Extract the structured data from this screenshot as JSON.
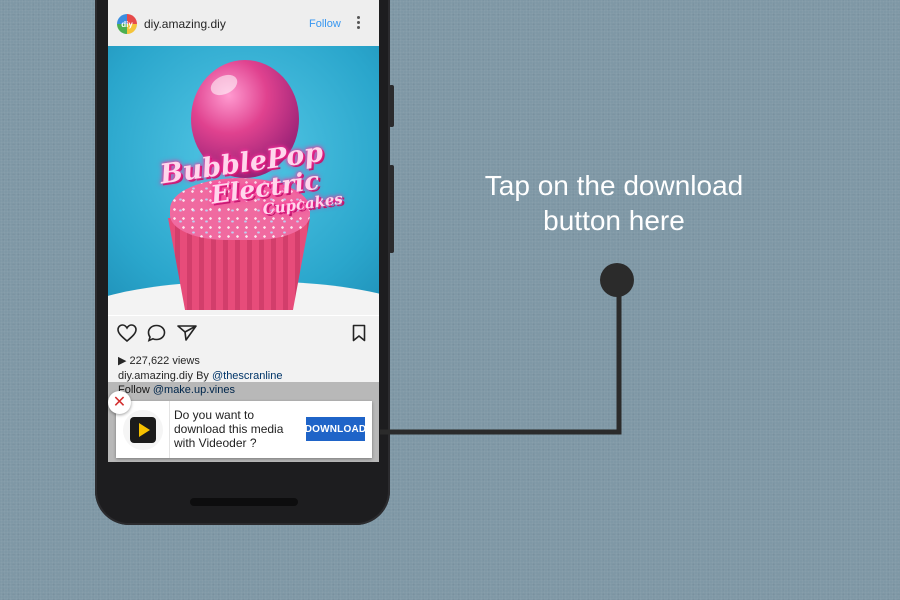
{
  "post": {
    "avatar_text": "diy",
    "username": "diy.amazing.diy",
    "follow_label": "Follow",
    "media_title": {
      "line1": "BubblePop",
      "line2": "Electric",
      "line3": "Cupcakes"
    },
    "views": "227,622 views",
    "caption_user": "diy.amazing.diy",
    "caption_by": "By",
    "caption_credit": "@thescranline",
    "follow_prefix": "Follow",
    "follow_handle": "@make.up.vines"
  },
  "download_prompt": {
    "close_symbol": "✕",
    "app_icon": "videoder-play-icon",
    "message": "Do you want to download this media with Videoder ?",
    "button_label": "DOWNLOAD"
  },
  "annotation": {
    "line1": "Tap on the download",
    "line2": "button here"
  },
  "colors": {
    "background": "#7f98a6",
    "follow": "#3897f0",
    "download_button": "#1f64c8",
    "close_x": "#d32f2f",
    "connector": "#2b2b2b"
  }
}
